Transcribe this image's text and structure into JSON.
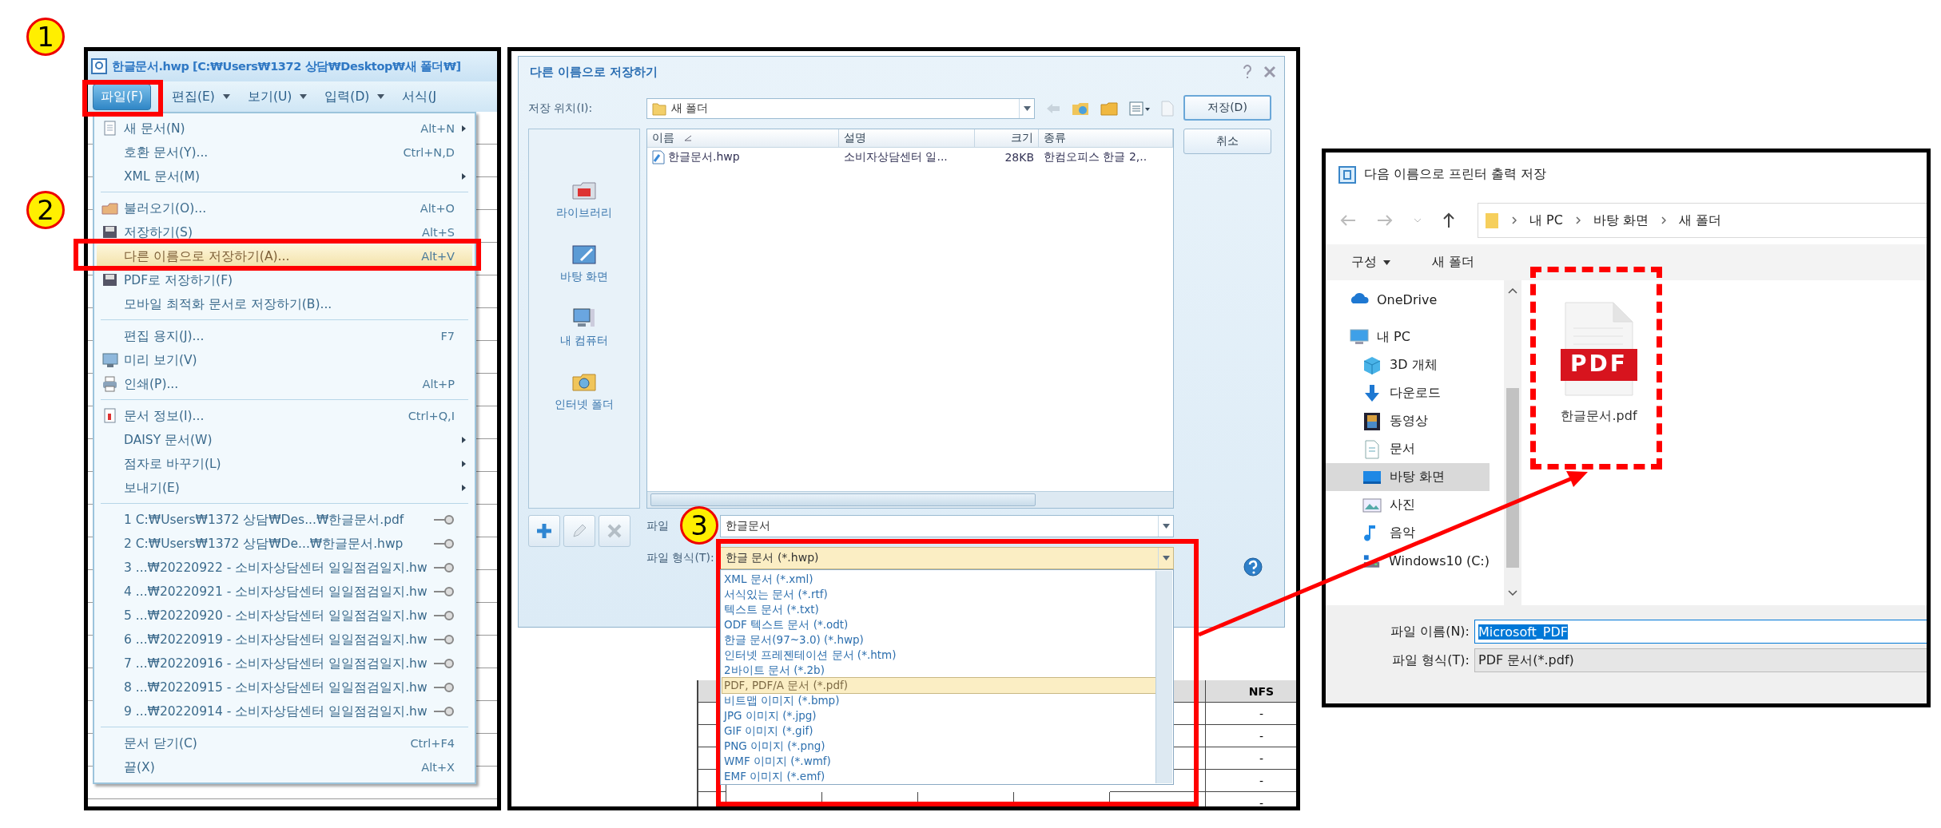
{
  "callouts": [
    {
      "number": "1"
    },
    {
      "number": "2"
    },
    {
      "number": "3"
    }
  ],
  "hwp_window": {
    "title": "한글문서.hwp [C:₩Users₩1372 상담₩Desktop₩새 폴더₩]",
    "menubar": [
      {
        "label": "파일(F)",
        "selected": true,
        "dropdown": false
      },
      {
        "label": "편집(E)",
        "selected": false,
        "dropdown": true
      },
      {
        "label": "보기(U)",
        "selected": false,
        "dropdown": true
      },
      {
        "label": "입력(D)",
        "selected": false,
        "dropdown": true
      },
      {
        "label": "서식(J",
        "selected": false,
        "dropdown": false
      }
    ],
    "file_menu": [
      {
        "kind": "item",
        "label": "새 문서(N)",
        "shortcut": "Alt+N",
        "submenu": true,
        "highlighted": false
      },
      {
        "kind": "item",
        "label": "호환 문서(Y)...",
        "shortcut": "Ctrl+N,D",
        "submenu": false,
        "highlighted": false
      },
      {
        "kind": "item",
        "label": "XML 문서(M)",
        "submenu": true,
        "highlighted": false
      },
      {
        "kind": "separator"
      },
      {
        "kind": "item",
        "label": "불러오기(O)...",
        "shortcut": "Alt+O",
        "submenu": false,
        "highlighted": false
      },
      {
        "kind": "item",
        "label": "저장하기(S)",
        "shortcut": "Alt+S",
        "submenu": false,
        "highlighted": false
      },
      {
        "kind": "item",
        "label": "다른 이름으로 저장하기(A)...",
        "shortcut": "Alt+V",
        "submenu": false,
        "highlighted": true
      },
      {
        "kind": "item",
        "label": "PDF로 저장하기(F)",
        "submenu": false,
        "highlighted": false
      },
      {
        "kind": "item",
        "label": "모바일 최적화 문서로 저장하기(B)...",
        "submenu": false,
        "highlighted": false
      },
      {
        "kind": "separator"
      },
      {
        "kind": "item",
        "label": "편집 용지(J)...",
        "shortcut": "F7",
        "submenu": false,
        "highlighted": false
      },
      {
        "kind": "item",
        "label": "미리 보기(V)",
        "submenu": false,
        "highlighted": false
      },
      {
        "kind": "item",
        "label": "인쇄(P)...",
        "shortcut": "Alt+P",
        "submenu": false,
        "highlighted": false
      },
      {
        "kind": "separator"
      },
      {
        "kind": "item",
        "label": "문서 정보(I)...",
        "shortcut": "Ctrl+Q,I",
        "submenu": false,
        "highlighted": false
      },
      {
        "kind": "item",
        "label": "DAISY 문서(W)",
        "submenu": true,
        "highlighted": false
      },
      {
        "kind": "item",
        "label": "점자로 바꾸기(L)",
        "submenu": true,
        "highlighted": false
      },
      {
        "kind": "item",
        "label": "보내기(E)",
        "submenu": true,
        "highlighted": false
      },
      {
        "kind": "separator"
      },
      {
        "kind": "recent",
        "label": "1 C:₩Users₩1372 상담₩Des...₩한글문서.pdf",
        "submenu": false,
        "highlighted": false
      },
      {
        "kind": "recent",
        "label": "2 C:₩Users₩1372 상담₩De...₩한글문서.hwp",
        "submenu": false,
        "highlighted": false
      },
      {
        "kind": "recent",
        "label": "3 ...₩20220922 - 소비자상담센터 일일점검일지.hw",
        "submenu": false,
        "highlighted": false
      },
      {
        "kind": "recent",
        "label": "4 ...₩20220921 - 소비자상담센터 일일점검일지.hw",
        "submenu": false,
        "highlighted": false
      },
      {
        "kind": "recent",
        "label": "5 ...₩20220920 - 소비자상담센터 일일점검일지.hw",
        "submenu": false,
        "highlighted": false
      },
      {
        "kind": "recent",
        "label": "6 ...₩20220919 - 소비자상담센터 일일점검일지.hw",
        "submenu": false,
        "highlighted": false
      },
      {
        "kind": "recent",
        "label": "7 ...₩20220916 - 소비자상담센터 일일점검일지.hw",
        "submenu": false,
        "highlighted": false
      },
      {
        "kind": "recent",
        "label": "8 ...₩20220915 - 소비자상담센터 일일점검일지.hw",
        "submenu": false,
        "highlighted": false
      },
      {
        "kind": "recent",
        "label": "9 ...₩20220914 - 소비자상담센터 일일점검일지.hw",
        "submenu": false,
        "highlighted": false
      },
      {
        "kind": "separator"
      },
      {
        "kind": "item",
        "label": "문서 닫기(C)",
        "shortcut": "Ctrl+F4",
        "submenu": false,
        "highlighted": false
      },
      {
        "kind": "item",
        "label": "끝(X)",
        "shortcut": "Alt+X",
        "submenu": false,
        "highlighted": false
      }
    ]
  },
  "save_dialog": {
    "title": "다른 이름으로 저장하기",
    "location_label": "저장 위치(I):",
    "location": "새 폴더",
    "buttons": [
      {
        "label": "저장(D)",
        "default": true
      },
      {
        "label": "취소",
        "default": false
      }
    ],
    "places": [
      {
        "label": "라이브러리"
      },
      {
        "label": "바탕 화면"
      },
      {
        "label": "내 컴퓨터"
      },
      {
        "label": "인터넷 폴더"
      }
    ],
    "file_list": {
      "columns": [
        "이름",
        "설명",
        "크기",
        "종류"
      ],
      "rows": [
        {
          "cells": [
            "한글문서.hwp",
            "소비자상담센터 일...",
            "28KB",
            "한컴오피스 한글 2,.."
          ]
        }
      ]
    },
    "file_name_label": "파일",
    "file_name": "한글문서",
    "file_type_label": "파일 형식(T):",
    "file_type": "한글 문서 (*.hwp)",
    "file_type_options": [
      {
        "label": "XML 문서 (*.xml)",
        "selected": false
      },
      {
        "label": "서식있는 문서 (*.rtf)",
        "selected": false
      },
      {
        "label": "텍스트 문서 (*.txt)",
        "selected": false
      },
      {
        "label": "ODF 텍스트 문서 (*.odt)",
        "selected": false
      },
      {
        "label": "한글 문서(97~3.0) (*.hwp)",
        "selected": false
      },
      {
        "label": "인터넷 프레젠테이션 문서 (*.htm)",
        "selected": false
      },
      {
        "label": "2바이트 문서 (*.2b)",
        "selected": false
      },
      {
        "label": "PDF, PDF/A 문서 (*.pdf)",
        "selected": true
      },
      {
        "label": "비트맵 이미지 (*.bmp)",
        "selected": false
      },
      {
        "label": "JPG 이미지 (*.jpg)",
        "selected": false
      },
      {
        "label": "GIF 이미지 (*.gif)",
        "selected": false
      },
      {
        "label": "PNG 이미지 (*.png)",
        "selected": false
      },
      {
        "label": "WMF 이미지 (*.wmf)",
        "selected": false
      },
      {
        "label": "EMF 이미지 (*.emf)",
        "selected": false
      }
    ]
  },
  "document_table": {
    "header": "NFS",
    "cells": [
      "-",
      "-",
      "-",
      "-",
      "-"
    ]
  },
  "print_dialog": {
    "title": "다음 이름으로 프린터 출력 저장",
    "breadcrumb": [
      "내 PC",
      "바탕 화면",
      "새 폴더"
    ],
    "toolbar": [
      {
        "label": "구성",
        "dropdown": true
      },
      {
        "label": "새 폴더",
        "dropdown": false
      }
    ],
    "nav_tree": [
      {
        "label": "OneDrive",
        "selected": false
      },
      {
        "label": "내 PC",
        "selected": false,
        "children": [
          {
            "label": "3D 개체",
            "selected": false
          },
          {
            "label": "다운로드",
            "selected": false
          },
          {
            "label": "동영상",
            "selected": false
          },
          {
            "label": "문서",
            "selected": false
          },
          {
            "label": "바탕 화면",
            "selected": true
          },
          {
            "label": "사진",
            "selected": false
          },
          {
            "label": "음악",
            "selected": false
          },
          {
            "label": "Windows10 (C:)",
            "selected": false
          }
        ]
      }
    ],
    "files": [
      {
        "name": "한글문서.pdf",
        "badge": "PDF"
      }
    ],
    "file_name_label": "파일 이름(N):",
    "file_name": {
      "value": "Microsoft_PDF",
      "text_selected": true
    },
    "file_type_label": "파일 형식(T):",
    "file_type": "PDF 문서(*.pdf)"
  }
}
